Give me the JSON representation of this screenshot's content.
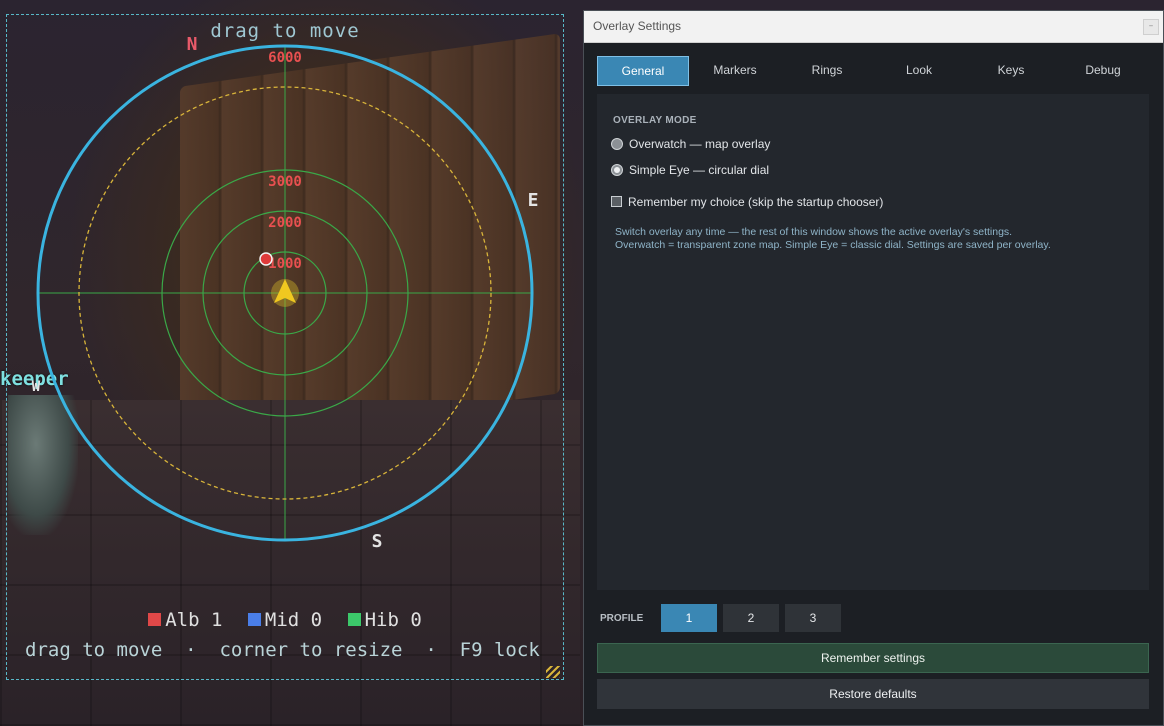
{
  "game": {
    "npc_name": "keeper"
  },
  "dial": {
    "title": "drag to move",
    "compass": {
      "n": "N",
      "e": "E",
      "s": "S",
      "w": "W"
    },
    "ring_labels": [
      "6000",
      "3000",
      "2000",
      "1000"
    ],
    "legend": [
      {
        "label": "Alb",
        "count": "1",
        "color": "#e04848"
      },
      {
        "label": "Mid",
        "count": "0",
        "color": "#4a7ee8"
      },
      {
        "label": "Hib",
        "count": "0",
        "color": "#3cc86a"
      }
    ],
    "hint": "drag to move  ·  corner to resize  ·  F9 lock",
    "colors": {
      "outer_ring": "#3ab4e0",
      "dashed_ring": "#d8b43a",
      "inner_rings": "#3aa848",
      "player": "#f0c820",
      "enemy": "#e03a3a"
    }
  },
  "settings": {
    "window_title": "Overlay Settings",
    "tabs": [
      "General",
      "Markers",
      "Rings",
      "Look",
      "Keys",
      "Debug"
    ],
    "active_tab": "General",
    "section_title": "OVERLAY MODE",
    "mode_options": [
      {
        "label": "Overwatch  —  map overlay",
        "selected": false
      },
      {
        "label": "Simple Eye  —  circular dial",
        "selected": true
      }
    ],
    "remember_choice_label": "Remember my choice (skip the startup chooser)",
    "remember_choice_checked": false,
    "note_lines": [
      "Switch overlay any time — the rest of this window shows the active overlay's settings.",
      "Overwatch = transparent zone map. Simple Eye = classic dial. Settings are saved per overlay."
    ],
    "profile_label": "PROFILE",
    "profiles": [
      "1",
      "2",
      "3"
    ],
    "active_profile": "1",
    "remember_button": "Remember settings",
    "restore_button": "Restore defaults"
  }
}
